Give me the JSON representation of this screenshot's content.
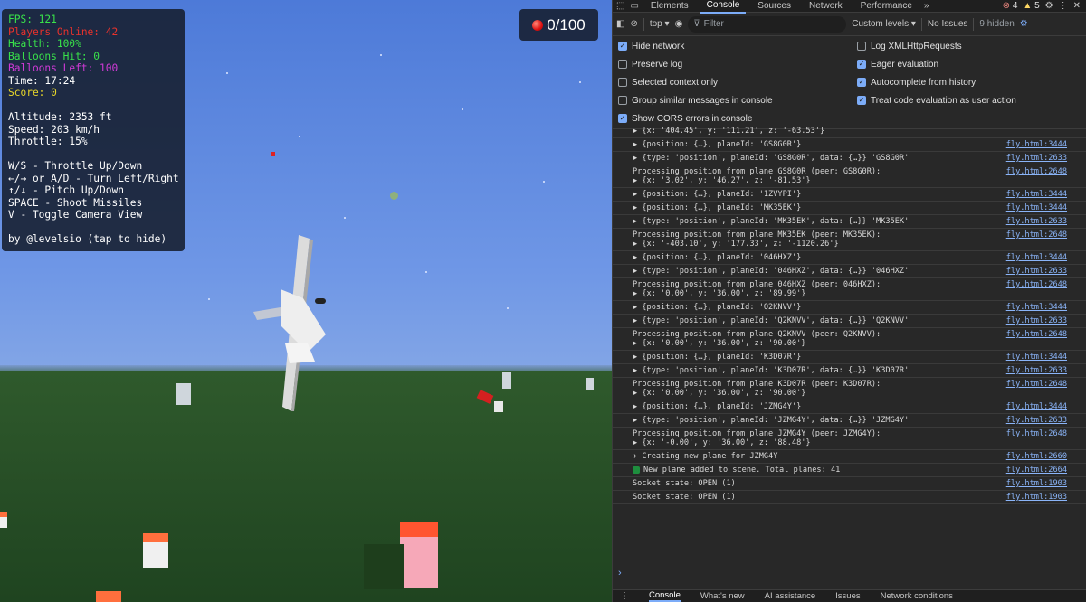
{
  "game": {
    "hud": {
      "fps": "FPS: 121",
      "players": "Players Online: 42",
      "health": "Health: 100%",
      "balloons_hit": "Balloons Hit: 0",
      "balloons_left": "Balloons Left: 100",
      "time": "Time: 17:24",
      "score": "Score: 0",
      "altitude": "Altitude: 2353 ft",
      "speed": "Speed: 203 km/h",
      "throttle": "Throttle: 15%",
      "ctrl1": "W/S - Throttle Up/Down",
      "ctrl2": "←/→ or A/D - Turn Left/Right",
      "ctrl3": "↑/↓ - Pitch Up/Down",
      "ctrl4": "SPACE - Shoot Missiles",
      "ctrl5": "V - Toggle Camera View",
      "credit": "by @levelsio (tap to hide)"
    },
    "balloon_counter": "0/100",
    "colors": {
      "players": "#e8322c",
      "health": "#39e24a",
      "balloons_left": "#d23ad8",
      "score": "#e7d62a"
    }
  },
  "devtools": {
    "tabs": [
      "Elements",
      "Console",
      "Sources",
      "Network",
      "Performance"
    ],
    "active_tab": "Console",
    "badges": {
      "errors": "4",
      "warnings": "5"
    },
    "toolbar": {
      "context": "top",
      "filter_placeholder": "Filter",
      "levels": "Custom levels",
      "issues": "No Issues",
      "hidden": "9 hidden"
    },
    "settings": [
      {
        "label": "Hide network",
        "checked": true
      },
      {
        "label": "Log XMLHttpRequests",
        "checked": false
      },
      {
        "label": "Preserve log",
        "checked": false
      },
      {
        "label": "Eager evaluation",
        "checked": true
      },
      {
        "label": "Selected context only",
        "checked": false
      },
      {
        "label": "Autocomplete from history",
        "checked": true
      },
      {
        "label": "Group similar messages in console",
        "checked": false
      },
      {
        "label": "Treat code evaluation as user action",
        "checked": true
      },
      {
        "label": "Show CORS errors in console",
        "checked": true
      }
    ],
    "log": [
      {
        "text": "▶ {x: '404.45', y: '111.21', z: '-63.53'}",
        "src": ""
      },
      {
        "text": "▶ {position: {…}, planeId: 'GS8G0R'}",
        "src": "fly.html:3444"
      },
      {
        "text": "▶ {type: 'position', planeId: 'GS8G0R', data: {…}} 'GS8G0R'",
        "src": "fly.html:2633"
      },
      {
        "text": "Processing position from plane GS8G0R (peer: GS8G0R):",
        "sub": "▶ {x: '3.02', y: '46.27', z: '-81.53'}",
        "src": "fly.html:2648"
      },
      {
        "text": "▶ {position: {…}, planeId: '1ZVYPI'}",
        "src": "fly.html:3444"
      },
      {
        "text": "▶ {position: {…}, planeId: 'MK35EK'}",
        "src": "fly.html:3444"
      },
      {
        "text": "▶ {type: 'position', planeId: 'MK35EK', data: {…}} 'MK35EK'",
        "src": "fly.html:2633"
      },
      {
        "text": "Processing position from plane MK35EK (peer: MK35EK):",
        "sub": "▶ {x: '-403.10', y: '177.33', z: '-1120.26'}",
        "src": "fly.html:2648"
      },
      {
        "text": "▶ {position: {…}, planeId: '046HXZ'}",
        "src": "fly.html:3444"
      },
      {
        "text": "▶ {type: 'position', planeId: '046HXZ', data: {…}} '046HXZ'",
        "src": "fly.html:2633"
      },
      {
        "text": "Processing position from plane 046HXZ (peer: 046HXZ):",
        "sub": "▶ {x: '0.00', y: '36.00', z: '89.99'}",
        "src": "fly.html:2648"
      },
      {
        "text": "▶ {position: {…}, planeId: 'Q2KNVV'}",
        "src": "fly.html:3444"
      },
      {
        "text": "▶ {type: 'position', planeId: 'Q2KNVV', data: {…}} 'Q2KNVV'",
        "src": "fly.html:2633"
      },
      {
        "text": "Processing position from plane Q2KNVV (peer: Q2KNVV):",
        "sub": "▶ {x: '0.00', y: '36.00', z: '90.00'}",
        "src": "fly.html:2648"
      },
      {
        "text": "▶ {position: {…}, planeId: 'K3D07R'}",
        "src": "fly.html:3444"
      },
      {
        "text": "▶ {type: 'position', planeId: 'K3D07R', data: {…}} 'K3D07R'",
        "src": "fly.html:2633"
      },
      {
        "text": "Processing position from plane K3D07R (peer: K3D07R):",
        "sub": "▶ {x: '0.00', y: '36.00', z: '90.00'}",
        "src": "fly.html:2648"
      },
      {
        "text": "▶ {position: {…}, planeId: 'JZMG4Y'}",
        "src": "fly.html:3444"
      },
      {
        "text": "▶ {type: 'position', planeId: 'JZMG4Y', data: {…}} 'JZMG4Y'",
        "src": "fly.html:2633"
      },
      {
        "text": "Processing position from plane JZMG4Y (peer: JZMG4Y):",
        "sub": "▶ {x: '-0.00', y: '36.00', z: '88.48'}",
        "src": "fly.html:2648"
      },
      {
        "text": "✈ Creating new plane for JZMG4Y",
        "src": "fly.html:2660"
      },
      {
        "text": "New plane added to scene. Total planes: 41",
        "src": "fly.html:2664",
        "badge": true
      },
      {
        "text": "Socket state: OPEN (1)",
        "src": "fly.html:1903"
      },
      {
        "text": "Socket state: OPEN (1)",
        "src": "fly.html:1903"
      }
    ],
    "prompt": "›",
    "drawer_tabs": [
      "Console",
      "What's new",
      "AI assistance",
      "Issues",
      "Network conditions"
    ]
  }
}
